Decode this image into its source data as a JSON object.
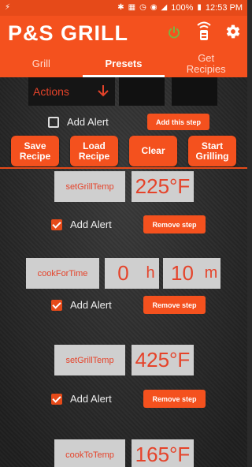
{
  "status_bar": {
    "battery": "100%",
    "time": "12:53 PM"
  },
  "app": {
    "title": "P&S GRILL"
  },
  "tabs": [
    {
      "label": "Grill"
    },
    {
      "label": "Presets"
    },
    {
      "label": "Get Recipies"
    }
  ],
  "controls": {
    "actions_label": "Actions",
    "add_alert_label": "Add Alert",
    "add_this_step_label": "Add this step",
    "save_recipe_label": "Save Recipe",
    "load_recipe_label": "Load Recipe",
    "clear_label": "Clear",
    "start_grilling_label": "Start Grilling"
  },
  "steps": [
    {
      "name": "setGrillTemp",
      "value": "225°F",
      "add_alert_label": "Add Alert",
      "remove_label": "Remove step"
    },
    {
      "name": "cookForTime",
      "hours": "0",
      "hours_unit": "h",
      "minutes": "10",
      "minutes_unit": "m",
      "add_alert_label": "Add Alert",
      "remove_label": "Remove step"
    },
    {
      "name": "setGrillTemp",
      "value": "425°F",
      "add_alert_label": "Add Alert",
      "remove_label": "Remove step"
    },
    {
      "name": "cookToTemp",
      "value": "165°F"
    }
  ],
  "colors": {
    "accent": "#f4511e",
    "status_bar": "#e64a19",
    "power_icon": "#7cb342"
  }
}
